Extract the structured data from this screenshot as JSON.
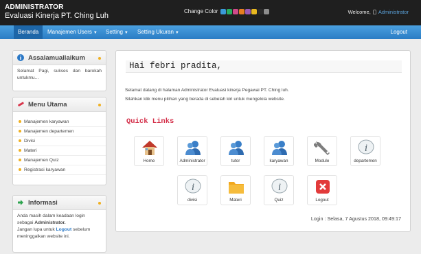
{
  "header": {
    "role": "ADMINISTRATOR",
    "app_title": "Evaluasi Kinerja PT. Ching Luh",
    "change_color_label": "Change Color",
    "welcome_label": "Welcome,",
    "user": "Administrator",
    "swatches": [
      "#3a9ad9",
      "#27ae60",
      "#d04a8a",
      "#e67e22",
      "#9b59b6",
      "#e8b820",
      "#2b2b2b",
      "#8e8e8e"
    ]
  },
  "nav": {
    "items": [
      {
        "label": "Beranda"
      },
      {
        "label": "Manajemen Users"
      },
      {
        "label": "Setting"
      },
      {
        "label": "Setting Ukuran"
      }
    ],
    "logout": "Logout"
  },
  "sidebar": {
    "greeting": {
      "title": "Assalamuallaikum",
      "text": "Selamat Pagi, sukses dan barokah untukmu..."
    },
    "menu": {
      "title": "Menu Utama",
      "items": [
        "Manajemen karyawan",
        "Manajemen departemen",
        "Divisi",
        "Materi",
        "Manajemen Quiz",
        "Registrasi karyawan"
      ]
    },
    "info": {
      "title": "Informasi",
      "line1": "Anda masih dalam keadaan login",
      "line2a": "sebagai",
      "line2b": "Administrator.",
      "line3a": "Jangan lupa untuk",
      "logout_word": "Logout",
      "line3b": "sebelum",
      "line4": "meninggalkan website ini."
    }
  },
  "main": {
    "greeting": "Hai febri pradita,",
    "intro1": "Selamat datang di halaman Administrator Evaluasi kinerja Pegawai PT. Ching luh.",
    "intro2": "Silahkan klik menu pilihan yang berada di sebelah kiri untuk mengelola website.",
    "quick_links_title": "Quick Links",
    "links": [
      {
        "label": "Home",
        "icon": "home-icon"
      },
      {
        "label": "Administrator",
        "icon": "users-icon"
      },
      {
        "label": "tutor",
        "icon": "users-icon"
      },
      {
        "label": "karyawan",
        "icon": "users-icon"
      },
      {
        "label": "Module",
        "icon": "wrench-icon"
      },
      {
        "label": "departemen",
        "icon": "info-icon"
      },
      {
        "label": "divisi",
        "icon": "info-icon"
      },
      {
        "label": "Materi",
        "icon": "folder-icon"
      },
      {
        "label": "Quiz",
        "icon": "info-icon"
      },
      {
        "label": "Logout",
        "icon": "close-icon"
      }
    ],
    "login_info": "Login : Selasa, 7 Agustus 2018, 09:49:17"
  }
}
